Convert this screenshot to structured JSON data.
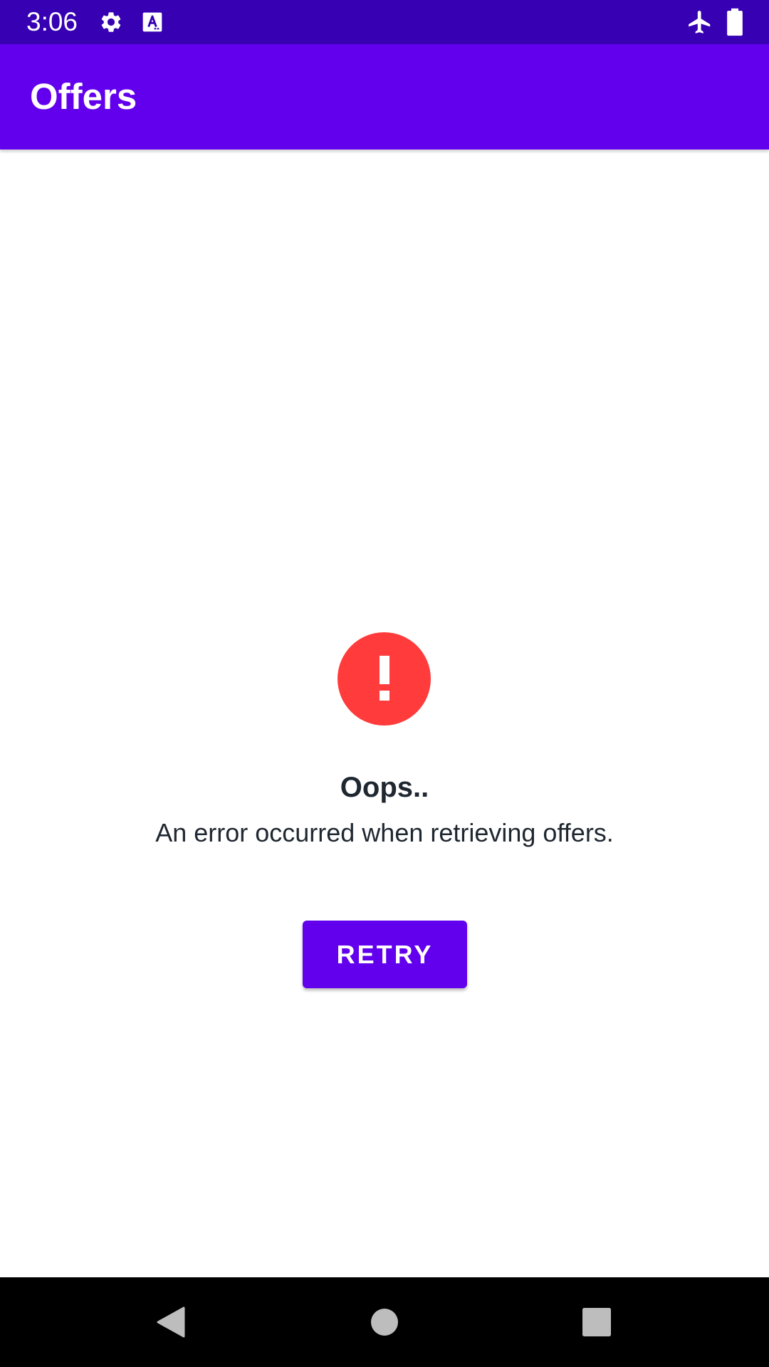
{
  "status_bar": {
    "time": "3:06",
    "icons": [
      "gear-icon",
      "text-a-icon",
      "airplane-mode-icon",
      "battery-icon"
    ]
  },
  "app_bar": {
    "title": "Offers"
  },
  "error": {
    "icon": "error-exclamation-icon",
    "title": "Oops..",
    "message": "An error occurred when retrieving offers.",
    "retry_label": "RETRY"
  },
  "nav_bar": {
    "buttons": [
      "back-icon",
      "home-icon",
      "recents-icon"
    ]
  },
  "colors": {
    "status_bar": "#3700b3",
    "primary": "#6200ee",
    "error": "#ff3b3b",
    "text": "#1f2730"
  }
}
